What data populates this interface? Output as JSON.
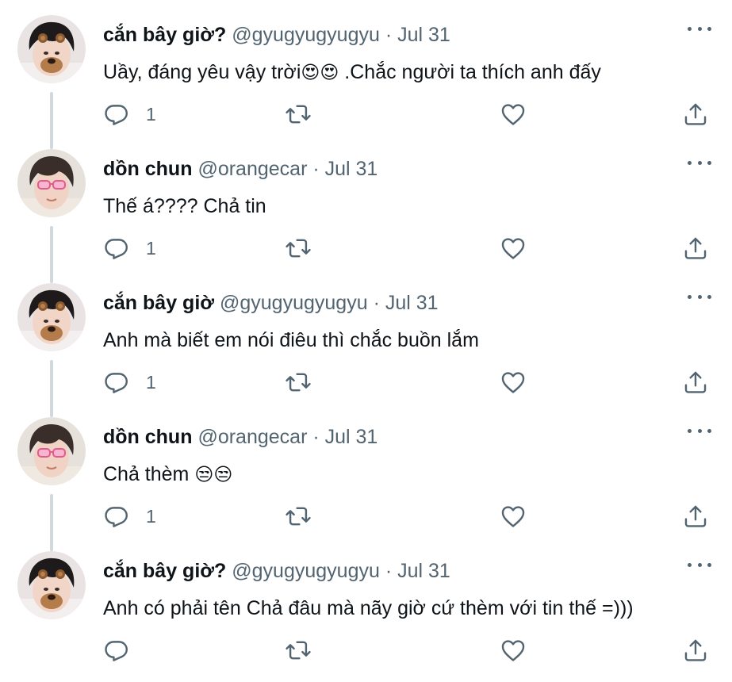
{
  "tweets": [
    {
      "name": "cắn bây giờ?",
      "handle": "@gyugyugyugyu",
      "dot": "·",
      "date": "Jul 31",
      "text": "Uầy, đáng yêu vậy trời",
      "emoji": "😍😍",
      "text_after": " .Chắc người ta thích anh đấy",
      "reply_count": "1",
      "avatar": "bear-filter-avatar"
    },
    {
      "name": "dồn chun",
      "handle": "@orangecar",
      "dot": "·",
      "date": "Jul 31",
      "text": "Thế á???? Chả tin",
      "emoji": "",
      "text_after": "",
      "reply_count": "1",
      "avatar": "pink-glasses-avatar"
    },
    {
      "name": "cắn bây giờ",
      "handle": "@gyugyugyugyu",
      "dot": "·",
      "date": "Jul 31",
      "text": "Anh mà biết em nói điêu thì chắc buồn lắm",
      "emoji": "",
      "text_after": "",
      "reply_count": "1",
      "avatar": "bear-filter-avatar"
    },
    {
      "name": "dồn chun",
      "handle": "@orangecar",
      "dot": "·",
      "date": "Jul 31",
      "text": "Chả thèm ",
      "emoji": "😒😒",
      "text_after": "",
      "reply_count": "1",
      "avatar": "pink-glasses-avatar"
    },
    {
      "name": "cắn bây giờ?",
      "handle": "@gyugyugyugyu",
      "dot": "·",
      "date": "Jul 31",
      "text": "Anh có phải tên Chả đâu mà nãy giờ cứ thèm với tin thế =)))",
      "emoji": "",
      "text_after": "",
      "reply_count": "",
      "avatar": "bear-filter-avatar"
    }
  ],
  "icons": {
    "reply": "reply-icon",
    "retweet": "retweet-icon",
    "like": "like-icon",
    "share": "share-icon",
    "more": "more-icon"
  },
  "colors": {
    "text": "#0f1419",
    "secondary": "#536471",
    "thread_line": "#cfd9de"
  }
}
